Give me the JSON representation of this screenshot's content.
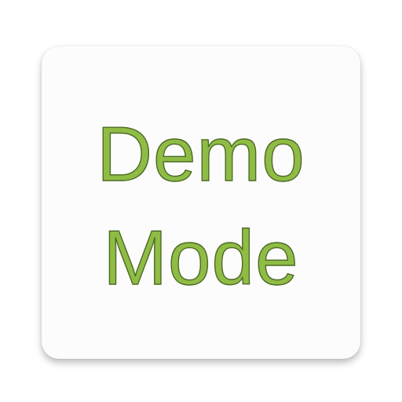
{
  "app_icon": {
    "line1": "Demo",
    "line2": "Mode",
    "text_color": "#8fbc45",
    "outline_color": "#4d6a25",
    "background_color": "#fcfcfc"
  }
}
